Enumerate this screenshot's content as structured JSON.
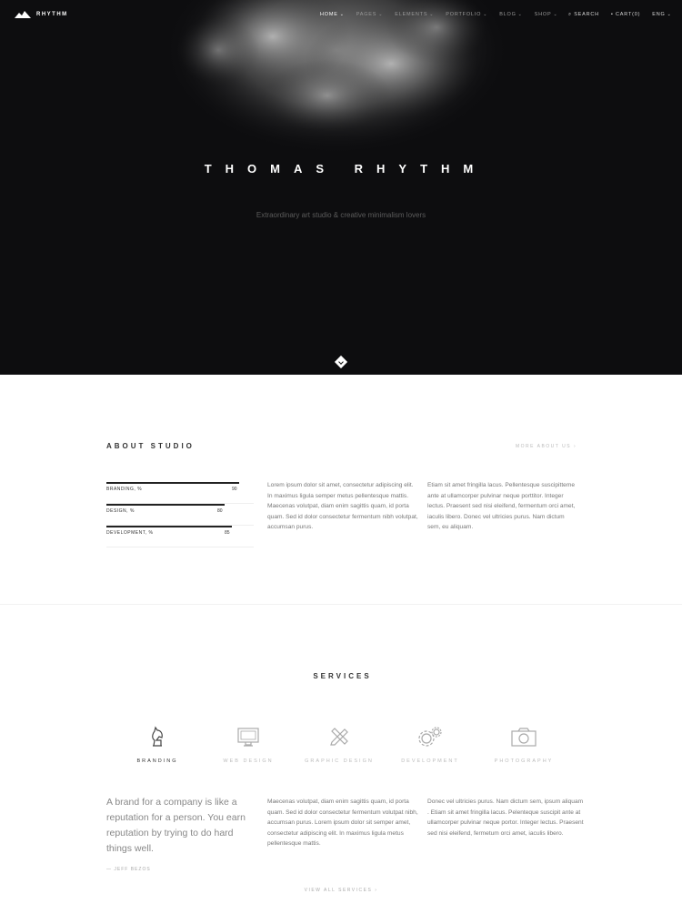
{
  "header": {
    "logo": "RHYTHM",
    "nav": [
      "HOME",
      "PAGES",
      "ELEMENTS",
      "PORTFOLIO",
      "BLOG",
      "SHOP"
    ],
    "search": "SEARCH",
    "cart": "CART(0)",
    "lang": "ENG"
  },
  "hero": {
    "title": "THOMAS RHYTHM",
    "subtitle": "Extraordinary art studio & creative minimalism lovers"
  },
  "about": {
    "title": "ABOUT STUDIO",
    "more_link": "MORE ABOUT US ›",
    "skills": [
      {
        "label": "BRANDING, %",
        "value": 90
      },
      {
        "label": "DESIGN, %",
        "value": 80
      },
      {
        "label": "DEVELOPMENT, %",
        "value": 85
      }
    ],
    "text_1": "Lorem ipsum dolor sit amet, consectetur adipiscing elit. In maximus ligula semper metus pellentesque mattis. Maecenas volutpat, diam enim sagittis quam, id porta quam. Sed id dolor consectetur fermentum nibh volutpat, accumsan purus.",
    "text_2": "Etiam sit amet fringilla lacus. Pellentesque suscipitteme ante at ullamcorper pulvinar neque porttitor. Integer lectus. Praesent sed nisi eleifend, fermentum orci amet, iaculis libero. Donec vel ultricies purus. Nam dictum sem, eu aliquam."
  },
  "services": {
    "title": "SERVICES",
    "tabs": [
      {
        "label": "BRANDING",
        "icon": "knight-icon"
      },
      {
        "label": "WEB DESIGN",
        "icon": "monitor-icon"
      },
      {
        "label": "GRAPHIC DESIGN",
        "icon": "pencil-ruler-icon"
      },
      {
        "label": "DEVELOPMENT",
        "icon": "gears-icon"
      },
      {
        "label": "PHOTOGRAPHY",
        "icon": "camera-icon"
      }
    ],
    "active_tab": "BRANDING",
    "quote": "A brand for a company is like a reputation for a person. You earn reputation by trying to do hard things well.",
    "quote_author": "— JEFF BEZOS",
    "text_1": "Maecenas volutpat, diam enim sagittis quam, id porta quam. Sed id dolor consectetur fermentum volutpat nibh, accumsan purus. Lorem ipsum dolor sit semper amet, consectetur adipiscing elit. In maximus ligula metus pellentesque mattis.",
    "text_2": "Donec vel ultricies purus. Nam dictum sem, ipsum aliquam . Etiam sit amet fringilla lacus. Pelenteque suscipit ante at ullamcorper pulvinar neque portor. Integer lectus. Praesent sed nisi eleifend, fermetum orci amet, iaculis libero.",
    "view_all": "VIEW ALL SERVICES ›"
  }
}
